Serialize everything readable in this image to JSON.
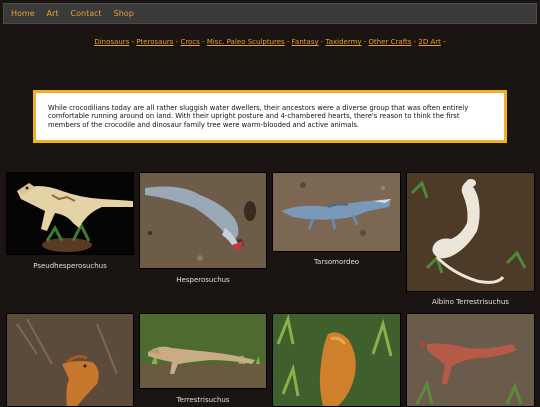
{
  "nav": {
    "items": [
      "Home",
      "Art",
      "Contact",
      "Shop"
    ]
  },
  "subnav": {
    "links": [
      "Dinosaurs",
      "Pterosaurs",
      "Crocs",
      "Misc. Paleo Sculptures",
      "Fantasy",
      "Taxidermy",
      "Other Crafts",
      "2D Art"
    ],
    "separator": " - "
  },
  "intro": {
    "text": "While crocodilians today are all rather sluggish water dwellers, their ancestors were a diverse group that was often entirely comfortable running around on land. With their upright posture and 4-chambered hearts, there's reason to think the first members of the crocodile and dinosaur family tree were warm-blooded and active animals."
  },
  "gallery": {
    "captions": [
      "Pseudhesperosuchus",
      "Hesperosuchus",
      "Tarsomordeo",
      "Albino Terrestrisuchus",
      "",
      "Terrestrisuchus",
      "",
      ""
    ]
  },
  "colors": {
    "accent": "#e8a030",
    "background": "#1a1512",
    "intro_border": "#f0b020"
  }
}
